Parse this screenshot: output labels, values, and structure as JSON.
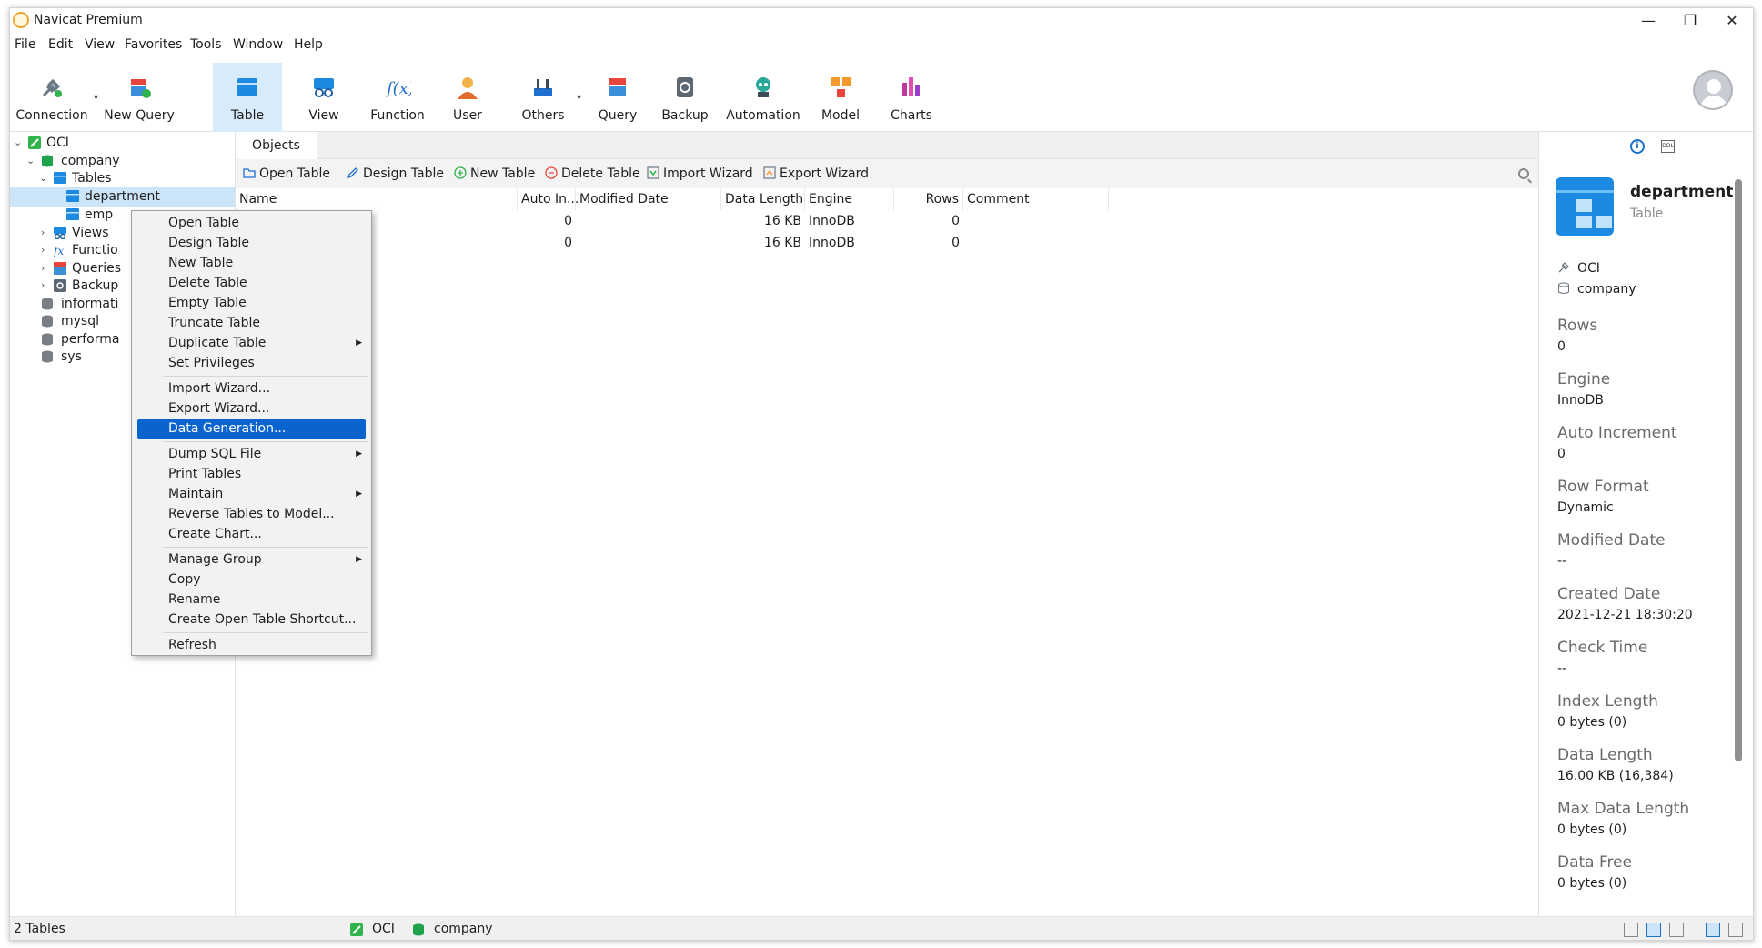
{
  "window": {
    "title": "Navicat Premium"
  },
  "menubar": {
    "items": [
      "File",
      "Edit",
      "View",
      "Favorites",
      "Tools",
      "Window",
      "Help"
    ]
  },
  "ribbon": {
    "buttons": [
      {
        "label": "Connection"
      },
      {
        "label": "New Query"
      },
      {
        "label": "Table"
      },
      {
        "label": "View"
      },
      {
        "label": "Function"
      },
      {
        "label": "User"
      },
      {
        "label": "Others"
      },
      {
        "label": "Query"
      },
      {
        "label": "Backup"
      },
      {
        "label": "Automation"
      },
      {
        "label": "Model"
      },
      {
        "label": "Charts"
      }
    ]
  },
  "tree": {
    "connection": "OCI",
    "database": "company",
    "tables_label": "Tables",
    "tables": [
      "department",
      "emp"
    ],
    "folders": [
      "Views",
      "Functio",
      "Queries",
      "Backup"
    ],
    "other_databases": [
      "informati",
      "mysql",
      "performa",
      "sys"
    ]
  },
  "objects": {
    "tab_label": "Objects",
    "toolbar": {
      "open_table": "Open Table",
      "design_table": "Design Table",
      "new_table": "New Table",
      "delete_table": "Delete Table",
      "import_wizard": "Import Wizard",
      "export_wizard": "Export Wizard"
    },
    "columns": [
      "Name",
      "Auto In...",
      "Modified Date",
      "Data Length",
      "Engine",
      "Rows",
      "Comment"
    ],
    "rows": [
      {
        "auto_inc": "0",
        "data_length": "16 KB",
        "engine": "InnoDB",
        "rows": "0"
      },
      {
        "auto_inc": "0",
        "data_length": "16 KB",
        "engine": "InnoDB",
        "rows": "0"
      }
    ]
  },
  "context_menu": {
    "items": [
      "Open Table",
      "Design Table",
      "New Table",
      "Delete Table",
      "Empty Table",
      "Truncate Table",
      "Duplicate Table",
      "Set Privileges",
      "Import Wizard...",
      "Export Wizard...",
      "Data Generation...",
      "Dump SQL File",
      "Print Tables",
      "Maintain",
      "Reverse Tables to Model...",
      "Create Chart...",
      "Manage Group",
      "Copy",
      "Rename",
      "Create Open Table Shortcut...",
      "Refresh"
    ],
    "highlighted": "Data Generation..."
  },
  "info": {
    "name": "department",
    "type": "Table",
    "connection": "OCI",
    "database": "company",
    "properties": [
      {
        "label": "Rows",
        "value": "0"
      },
      {
        "label": "Engine",
        "value": "InnoDB"
      },
      {
        "label": "Auto Increment",
        "value": "0"
      },
      {
        "label": "Row Format",
        "value": "Dynamic"
      },
      {
        "label": "Modified Date",
        "value": "--"
      },
      {
        "label": "Created Date",
        "value": "2021-12-21 18:30:20"
      },
      {
        "label": "Check Time",
        "value": "--"
      },
      {
        "label": "Index Length",
        "value": "0 bytes (0)"
      },
      {
        "label": "Data Length",
        "value": "16.00 KB (16,384)"
      },
      {
        "label": "Max Data Length",
        "value": "0 bytes (0)"
      },
      {
        "label": "Data Free",
        "value": "0 bytes (0)"
      }
    ]
  },
  "statusbar": {
    "count": "2 Tables",
    "connection": "OCI",
    "database": "company"
  },
  "colors": {
    "accent": "#0a64d0",
    "ribbon_active": "#d8ebfa",
    "selection": "#cce4f7"
  }
}
